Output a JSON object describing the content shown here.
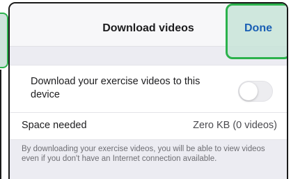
{
  "nav": {
    "title": "Download videos",
    "done_label": "Done"
  },
  "settings": {
    "download_label": "Download your exercise videos to this device",
    "download_enabled": false,
    "space_label": "Space needed",
    "space_value": "Zero KB (0 videos)"
  },
  "footnote": "By downloading your exercise videos, you will be able to view videos even if you don't have an Internet connection available.",
  "colors": {
    "accent": "#1a5fb4",
    "highlight_border": "#2bb24c"
  }
}
